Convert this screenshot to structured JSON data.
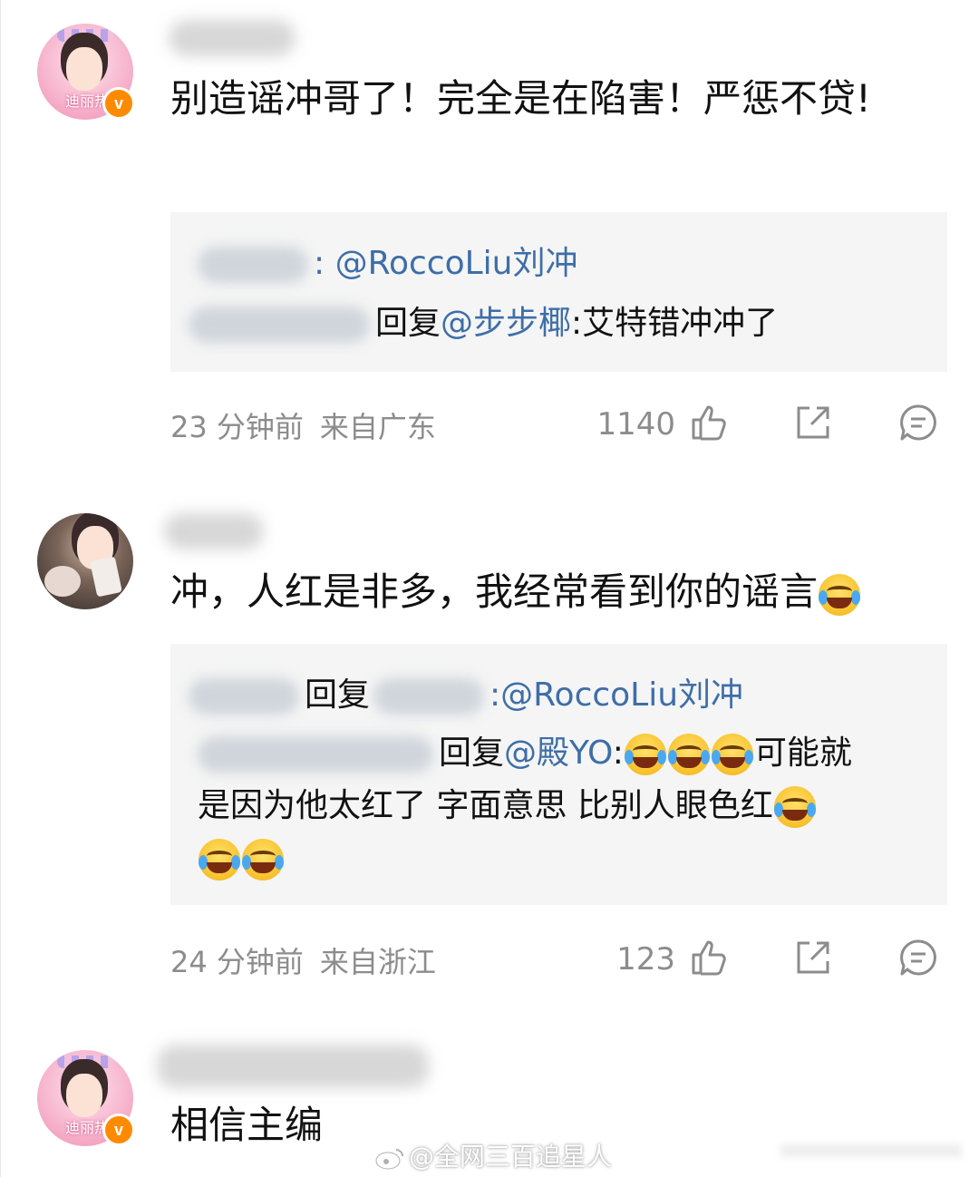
{
  "comments": [
    {
      "avatar_caption": "迪丽热",
      "verified_badge": "v",
      "text": "别造谣冲哥了！完全是在陷害！严惩不贷!",
      "quote": {
        "line1_text": ": @RoccoLiu刘冲",
        "line2_prefix": "回复",
        "line2_mention": "@步步椰",
        "line2_text": ":艾特错冲冲了"
      },
      "time": "23 分钟前",
      "location": "来自广东",
      "likes": "1140"
    },
    {
      "text": "冲，人红是非多，我经常看到你的谣言",
      "quote": {
        "line1_prefix": "回复",
        "line1_text": ":@RoccoLiu刘冲",
        "line2_prefix": "回复",
        "line2_mention": "@殿YO",
        "line2_suffix": ":",
        "line2_text": "可能就",
        "line3_text": "是因为他太红了 字面意思 比别人眼色红"
      },
      "time": "24 分钟前",
      "location": "来自浙江",
      "likes": "123"
    },
    {
      "avatar_caption": "迪丽热",
      "verified_badge": "v",
      "text": "相信主编"
    }
  ],
  "watermark": "@全网三百追星人",
  "icons": {
    "like": "thumbs-up-icon",
    "share": "share-icon",
    "comment": "comment-icon",
    "emoji_cry": "loudly-crying-emoji",
    "emoji_laugh": "tears-of-joy-emoji"
  }
}
